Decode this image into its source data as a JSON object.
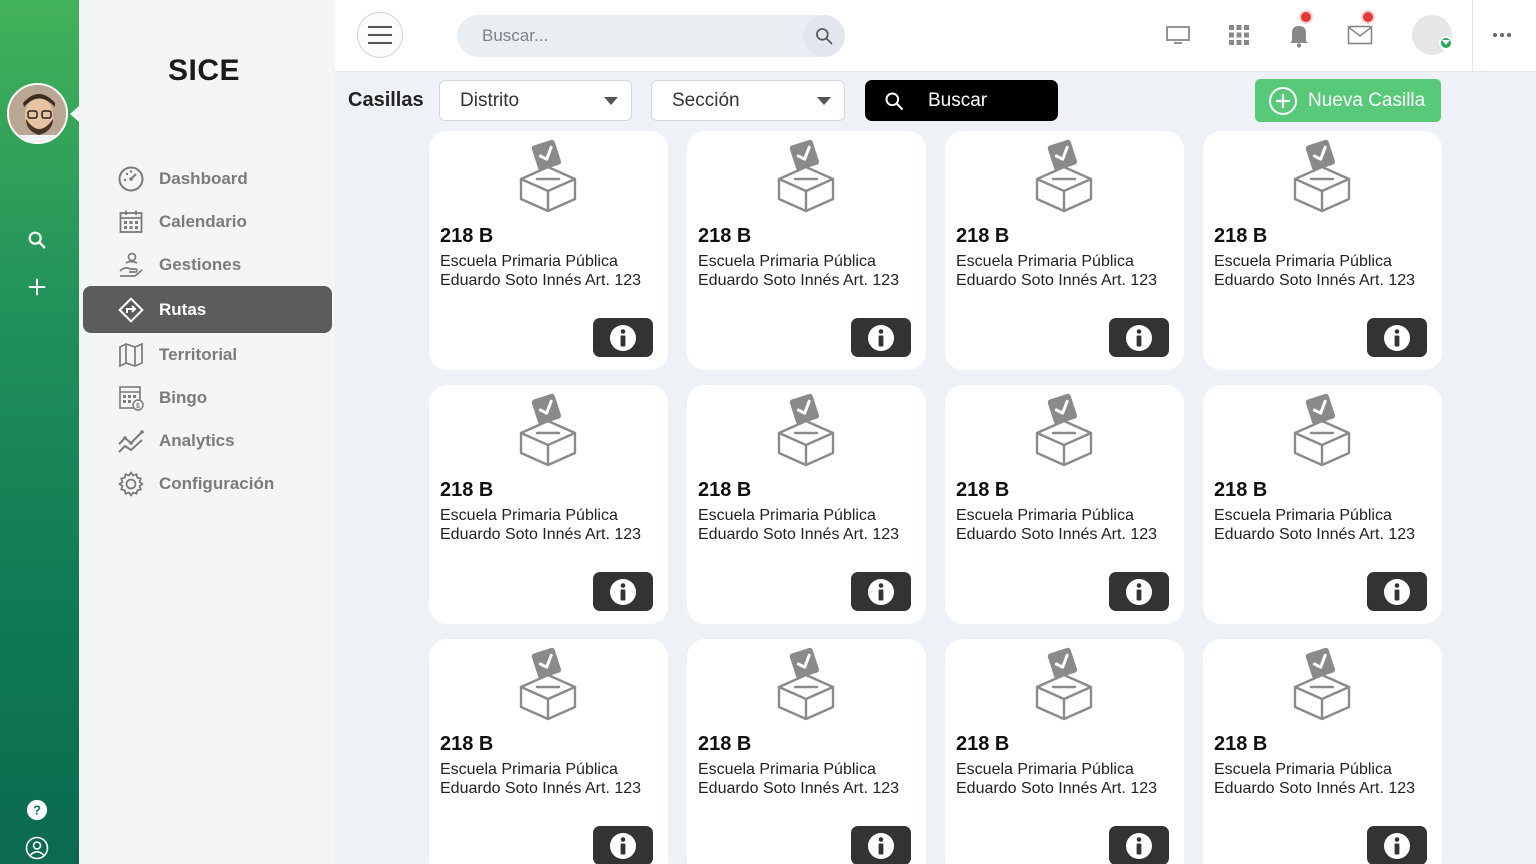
{
  "app": {
    "brand": "SICE"
  },
  "rail": {
    "icons": [
      "search-icon",
      "plus-icon",
      "help-icon",
      "account-icon"
    ]
  },
  "sidebar": {
    "items": [
      {
        "label": "Dashboard",
        "icon": "dashboard-icon"
      },
      {
        "label": "Calendario",
        "icon": "calendar-icon"
      },
      {
        "label": "Gestiones",
        "icon": "hand-coin-icon"
      },
      {
        "label": "Rutas",
        "icon": "route-icon",
        "active": true
      },
      {
        "label": "Territorial",
        "icon": "map-icon"
      },
      {
        "label": "Bingo",
        "icon": "bingo-icon"
      },
      {
        "label": "Analytics",
        "icon": "analytics-icon"
      },
      {
        "label": "Configuración",
        "icon": "gear-icon"
      }
    ]
  },
  "topbar": {
    "search_placeholder": "Buscar...",
    "icons": [
      "monitor-icon",
      "apps-grid-icon",
      "bell-icon",
      "mail-icon",
      "more-icon"
    ]
  },
  "page": {
    "title": "Casillas",
    "filter_distrito": "Distrito",
    "filter_seccion": "Sección",
    "buscar_label": "Buscar",
    "nueva_label": "Nueva Casilla"
  },
  "cards": [
    {
      "code": "218 B",
      "desc": "Escuela Primaria Pública Eduardo Soto Innés Art. 123"
    },
    {
      "code": "218 B",
      "desc": "Escuela Primaria Pública Eduardo Soto Innés Art. 123"
    },
    {
      "code": "218 B",
      "desc": "Escuela Primaria Pública Eduardo Soto Innés Art. 123"
    },
    {
      "code": "218 B",
      "desc": "Escuela Primaria Pública Eduardo Soto Innés Art. 123"
    },
    {
      "code": "218 B",
      "desc": "Escuela Primaria Pública Eduardo Soto Innés Art. 123"
    },
    {
      "code": "218 B",
      "desc": "Escuela Primaria Pública Eduardo Soto Innés Art. 123"
    },
    {
      "code": "218 B",
      "desc": "Escuela Primaria Pública Eduardo Soto Innés Art. 123"
    },
    {
      "code": "218 B",
      "desc": "Escuela Primaria Pública Eduardo Soto Innés Art. 123"
    },
    {
      "code": "218 B",
      "desc": "Escuela Primaria Pública Eduardo Soto Innés Art. 123"
    },
    {
      "code": "218 B",
      "desc": "Escuela Primaria Pública Eduardo Soto Innés Art. 123"
    },
    {
      "code": "218 B",
      "desc": "Escuela Primaria Pública Eduardo Soto Innés Art. 123"
    },
    {
      "code": "218 B",
      "desc": "Escuela Primaria Pública Eduardo Soto Innés Art. 123"
    }
  ],
  "colors": {
    "rail_top": "#43b25a",
    "rail_bottom": "#0b6a4f",
    "accent_green": "#58c978",
    "notify_red": "#e53935"
  }
}
